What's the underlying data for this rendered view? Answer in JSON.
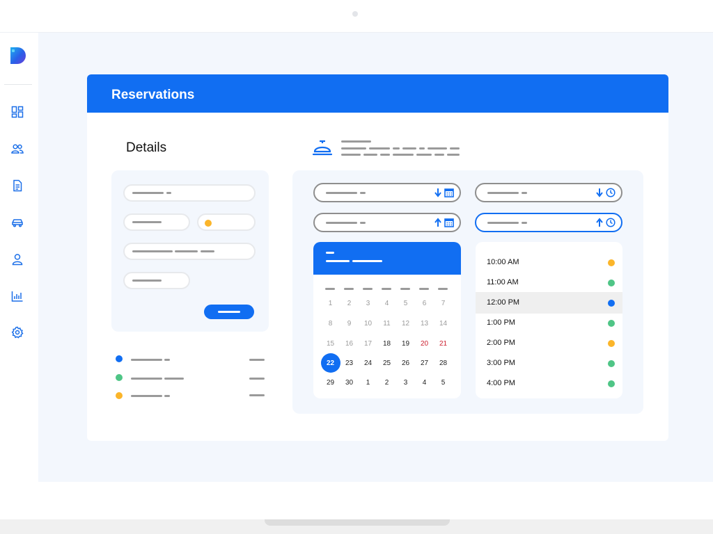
{
  "app": {
    "title": "Reservations"
  },
  "sidebar": {
    "items": [
      {
        "icon": "dashboard-icon"
      },
      {
        "icon": "users-icon"
      },
      {
        "icon": "document-icon"
      },
      {
        "icon": "car-icon"
      },
      {
        "icon": "user-icon"
      },
      {
        "icon": "chart-icon"
      },
      {
        "icon": "gear-icon"
      }
    ]
  },
  "details": {
    "title": "Details"
  },
  "header_icon": "service-bell-icon",
  "field_icons": [
    "arrow-down-icon",
    "calendar-icon",
    "arrow-up-icon",
    "clock-icon"
  ],
  "calendar": {
    "days": [
      [
        "1",
        "2",
        "3",
        "4",
        "5",
        "6",
        "7"
      ],
      [
        "8",
        "9",
        "10",
        "11",
        "12",
        "13",
        "14"
      ],
      [
        "15",
        "16",
        "17",
        "18",
        "19",
        "20",
        "21"
      ],
      [
        "22",
        "23",
        "24",
        "25",
        "26",
        "27",
        "28"
      ],
      [
        "29",
        "30",
        "1",
        "2",
        "3",
        "4",
        "5"
      ]
    ],
    "selected": "22"
  },
  "times": [
    {
      "label": "10:00 AM",
      "status_color": "#fbb52a"
    },
    {
      "label": "11:00 AM",
      "status_color": "#4fc586"
    },
    {
      "label": "12:00 PM",
      "status_color": "#116ef2",
      "highlighted": true
    },
    {
      "label": "1:00 PM",
      "status_color": "#4fc586"
    },
    {
      "label": "2:00 PM",
      "status_color": "#fbb52a"
    },
    {
      "label": "3:00 PM",
      "status_color": "#4fc586"
    },
    {
      "label": "4:00 PM",
      "status_color": "#4fc586"
    }
  ],
  "legend": [
    {
      "color": "#116ef2"
    },
    {
      "color": "#4fc586"
    },
    {
      "color": "#fbb52a"
    }
  ],
  "colors": {
    "accent": "#116ef2",
    "available": "#4fc586",
    "pending": "#fbb52a",
    "weekend": "#cc1f2e",
    "panel_bg": "#f3f7fd"
  }
}
